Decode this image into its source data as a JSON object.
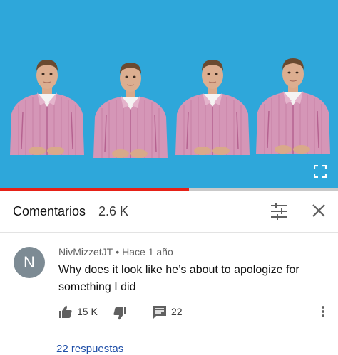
{
  "video": {
    "background_color": "#2ea7da",
    "progress_fraction": 0.56,
    "progress_color": "#e62117",
    "fullscreen_icon": "fullscreen-icon"
  },
  "comments": {
    "title": "Comentarios",
    "count": "2.6 K",
    "sort_icon": "sort-icon",
    "close_icon": "close-icon"
  },
  "comment": {
    "avatar_letter": "N",
    "author": "NivMizzetJT",
    "separator": "•",
    "time": "Hace 1 año",
    "text": "Why does it look like he’s about to apologize for something I did",
    "likes": "15 K",
    "reply_count": "22",
    "replies_link": "22 respuestas"
  }
}
